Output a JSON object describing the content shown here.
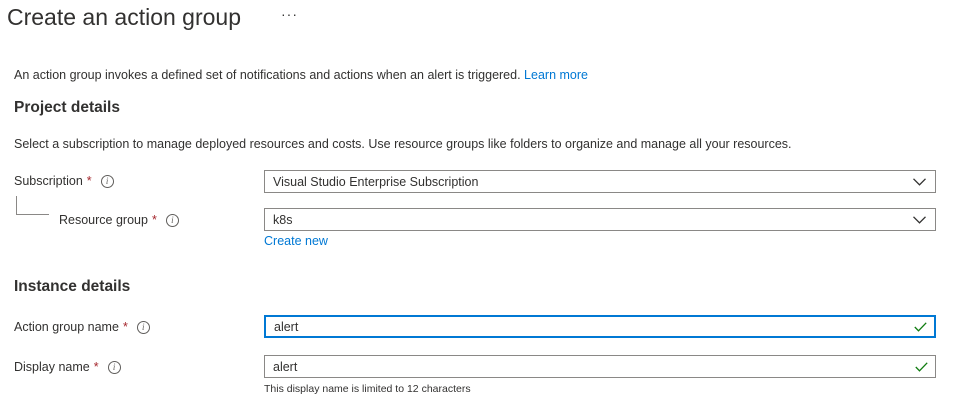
{
  "page": {
    "title": "Create an action group",
    "more_label": "···",
    "intro_text": "An action group invokes a defined set of notifications and actions when an alert is triggered.",
    "learn_more": "Learn more"
  },
  "project_details": {
    "heading": "Project details",
    "description": "Select a subscription to manage deployed resources and costs. Use resource groups like folders to organize and manage all your resources.",
    "subscription": {
      "label": "Subscription",
      "required_mark": "*",
      "value": "Visual Studio Enterprise Subscription"
    },
    "resource_group": {
      "label": "Resource group",
      "required_mark": "*",
      "value": "k8s",
      "create_new": "Create new"
    }
  },
  "instance_details": {
    "heading": "Instance details",
    "action_group_name": {
      "label": "Action group name",
      "required_mark": "*",
      "value": "alert",
      "valid": true
    },
    "display_name": {
      "label": "Display name",
      "required_mark": "*",
      "value": "alert",
      "valid": true,
      "hint": "This display name is limited to 12 characters"
    }
  },
  "icons": {
    "info": "info-icon",
    "chevron": "chevron-down-icon",
    "check": "checkmark-icon"
  },
  "colors": {
    "accent": "#0078d4",
    "required": "#a4262c",
    "valid": "#107c10",
    "border": "#8a8886"
  }
}
